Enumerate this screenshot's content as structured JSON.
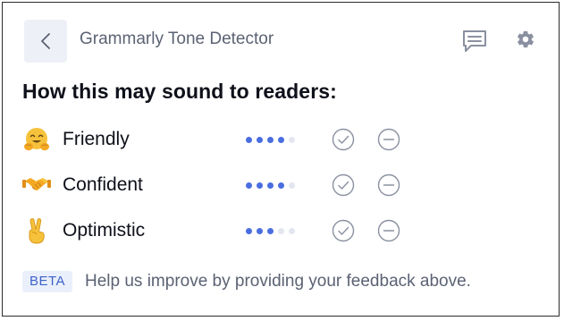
{
  "header": {
    "back_icon": "chevron-left-icon",
    "title": "Grammarly Tone Detector",
    "feedback_icon": "chat-bubble-icon",
    "settings_icon": "gear-icon"
  },
  "headline": "How this may sound to readers:",
  "tones": [
    {
      "emoji": "hugging-face-icon",
      "label": "Friendly",
      "level": 4,
      "max": 5
    },
    {
      "emoji": "handshake-icon",
      "label": "Confident",
      "level": 4,
      "max": 5
    },
    {
      "emoji": "victory-hand-icon",
      "label": "Optimistic",
      "level": 3,
      "max": 5
    }
  ],
  "footer": {
    "badge": "BETA",
    "text": "Help us improve by providing your feedback above."
  },
  "colors": {
    "dot_active": "#4a6ee0",
    "dot_inactive": "#e3e6ee",
    "icon_gray": "#8a90a0",
    "accent": "#3d63c9"
  }
}
